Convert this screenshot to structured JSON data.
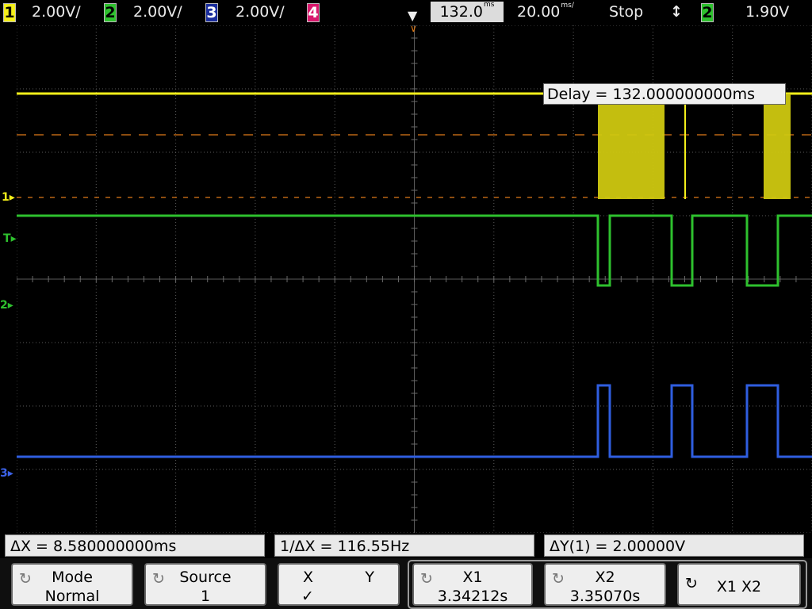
{
  "topbar": {
    "channels": [
      {
        "num": "1",
        "scale": "2.00V/",
        "color": "#f4ef1a"
      },
      {
        "num": "2",
        "scale": "2.00V/",
        "color": "#2ec12e"
      },
      {
        "num": "3",
        "scale": "2.00V/",
        "color": "#1a2d9c"
      },
      {
        "num": "4",
        "scale": "",
        "color": "#d8186c"
      }
    ],
    "delay": "132.0",
    "delay_unit": "ms",
    "timebase": "20.00",
    "timebase_unit": "ms/",
    "run_state": "Stop",
    "trigger_slope_icon": "rising-falling-edge-icon",
    "trigger_channel": "2",
    "trigger_level": "1.90V"
  },
  "screen": {
    "delay_readout": "Delay = 132.000000000ms",
    "markers": {
      "ch1": "1",
      "trigger": "T",
      "ch2": "2",
      "ch3": "3"
    }
  },
  "measurements": {
    "delta_x": "ΔX = 8.580000000ms",
    "inv_delta_x": "1/ΔX = 116.55Hz",
    "delta_y": "ΔY(1) = 2.00000V"
  },
  "softkeys": {
    "mode": {
      "label": "Mode",
      "value": "Normal"
    },
    "source": {
      "label": "Source",
      "value": "1"
    },
    "xy": {
      "x": "X",
      "y": "Y",
      "check": "✓"
    },
    "x1": {
      "label": "X1",
      "value": "3.34212s"
    },
    "x2": {
      "label": "X2",
      "value": "3.35070s"
    },
    "x1x2": {
      "label": "X1 X2"
    }
  }
}
